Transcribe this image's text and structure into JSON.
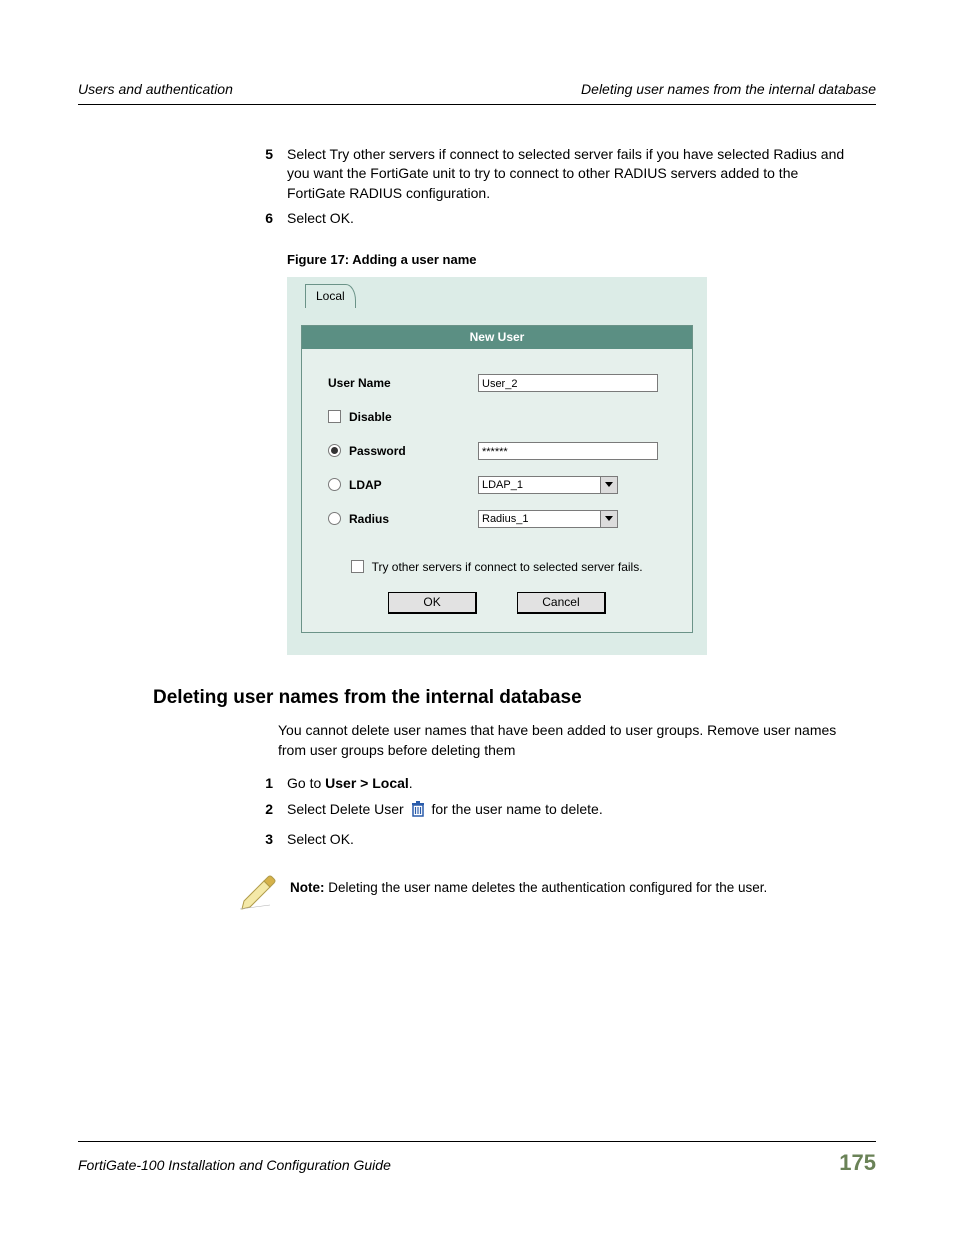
{
  "header_left": "Users and authentication",
  "header_right": "Deleting user names from the internal database",
  "pre_steps": {
    "s5_num": "5",
    "s5_text": "Select Try other servers if connect to selected server fails if you have selected Radius and you want the FortiGate unit to try to connect to other RADIUS servers added to the FortiGate RADIUS configuration.",
    "s6_num": "6",
    "s6_text": "Select OK."
  },
  "figure_caption": "Figure 17: Adding a user name",
  "form": {
    "tab_label": "Local",
    "panel_title": "New User",
    "username_label": "User Name",
    "username_value": "User_2",
    "disable_label": "Disable",
    "password_label": "Password",
    "password_value": "******",
    "ldap_label": "LDAP",
    "ldap_value": "LDAP_1",
    "radius_label": "Radius",
    "radius_value": "Radius_1",
    "try_other_label": "Try other servers if connect to selected server fails.",
    "ok_label": "OK",
    "cancel_label": "Cancel"
  },
  "section_heading": "Deleting user names from the internal database",
  "section_intro": "You cannot delete user names that have been added to user groups. Remove user names from user groups before deleting them",
  "del_steps": {
    "s1_num": "1",
    "s1_prefix": "Go to ",
    "s1_bold": "User > Local",
    "s1_suffix": ".",
    "s2_num": "2",
    "s2_prefix": "Select Delete User ",
    "s2_suffix": " for the user name to delete.",
    "s3_num": "3",
    "s3_text": "Select OK."
  },
  "note_label": "Note:",
  "note_text": " Deleting the user name deletes the authentication configured for the user.",
  "footer_title": "FortiGate-100 Installation and Configuration Guide",
  "page_number": "175"
}
